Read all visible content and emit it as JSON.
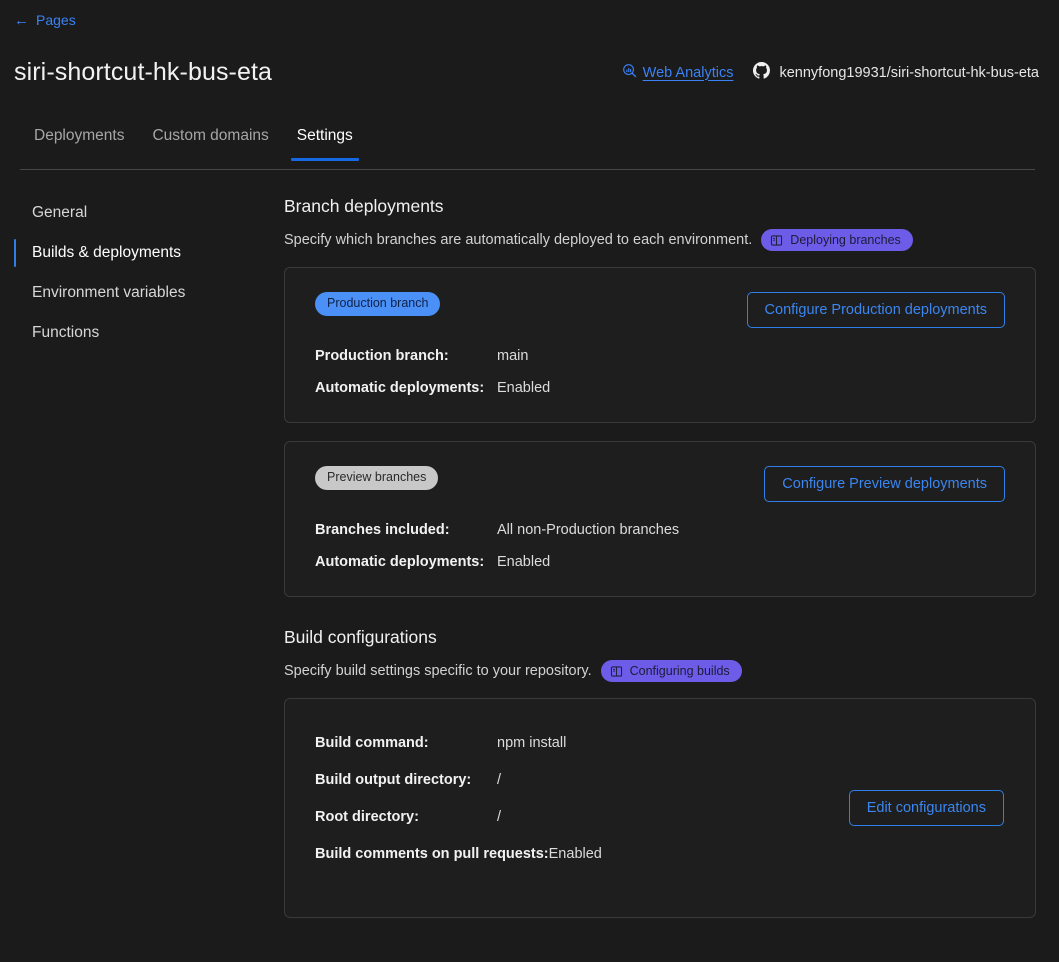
{
  "breadcrumb": {
    "icon": "arrow-left-icon",
    "label": "Pages",
    "arrow": "←"
  },
  "header": {
    "title": "siri-shortcut-hk-bus-eta",
    "analytics": {
      "icon": "analytics-search-icon",
      "label": "Web Analytics"
    },
    "repo": {
      "icon": "github-icon",
      "label": "kennyfong19931/siri-shortcut-hk-bus-eta"
    }
  },
  "tabs": [
    {
      "label": "Deployments",
      "active": false
    },
    {
      "label": "Custom domains",
      "active": false
    },
    {
      "label": "Settings",
      "active": true
    }
  ],
  "sidenav": [
    {
      "label": "General",
      "active": false
    },
    {
      "label": "Builds & deployments",
      "active": true
    },
    {
      "label": "Environment variables",
      "active": false
    },
    {
      "label": "Functions",
      "active": false
    }
  ],
  "branch_deployments": {
    "title": "Branch deployments",
    "description": "Specify which branches are automatically deployed to each environment.",
    "doc_badge": {
      "icon": "book-icon",
      "label": "Deploying branches"
    },
    "production": {
      "pill": "Production branch",
      "button": "Configure Production deployments",
      "rows": [
        {
          "key": "Production branch:",
          "value": "main"
        },
        {
          "key": "Automatic deployments:",
          "value": "Enabled"
        }
      ]
    },
    "preview": {
      "pill": "Preview branches",
      "button": "Configure Preview deployments",
      "rows": [
        {
          "key": "Branches included:",
          "value": "All non-Production branches"
        },
        {
          "key": "Automatic deployments:",
          "value": "Enabled"
        }
      ]
    }
  },
  "build_configurations": {
    "title": "Build configurations",
    "description": "Specify build settings specific to your repository.",
    "doc_badge": {
      "icon": "book-icon",
      "label": "Configuring builds"
    },
    "button": "Edit configurations",
    "rows": [
      {
        "key": "Build command:",
        "value": "npm install"
      },
      {
        "key": "Build output directory:",
        "value": "/"
      },
      {
        "key": "Root directory:",
        "value": "/"
      },
      {
        "key": "Build comments on pull requests:",
        "value": "Enabled"
      }
    ]
  },
  "colors": {
    "page_bg": "#1b1b1b",
    "card_bg": "#1e1e1e",
    "accent_blue": "#3b82f6",
    "tab_indicator": "#1668e3",
    "doc_badge_purple": "#6c5ce8",
    "production_pill": "#4a90f7",
    "preview_pill": "#c8c8c8"
  }
}
